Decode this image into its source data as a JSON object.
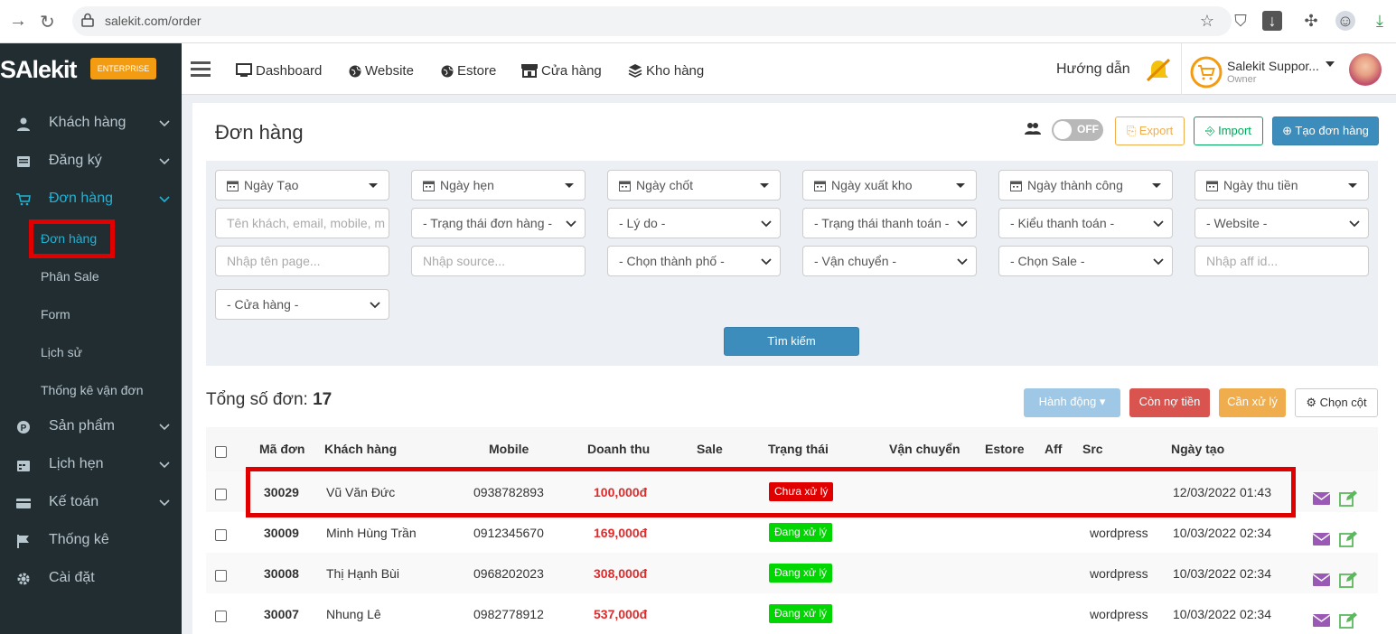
{
  "browser": {
    "url": "salekit.com/order"
  },
  "logo": {
    "text": "SAlekit",
    "badge": "ENTERPRISE"
  },
  "sidebar": {
    "items": [
      {
        "label": "Khách hàng",
        "icon": "user-icon"
      },
      {
        "label": "Đăng ký",
        "icon": "list-icon"
      },
      {
        "label": "Đơn hàng",
        "icon": "cart-icon"
      },
      {
        "label": "Sản phẩm",
        "icon": "product-icon"
      },
      {
        "label": "Lịch hẹn",
        "icon": "calendar-icon"
      },
      {
        "label": "Kế toán",
        "icon": "card-icon"
      },
      {
        "label": "Thống kê",
        "icon": "flag-icon"
      },
      {
        "label": "Cài đặt",
        "icon": "gear-icon"
      }
    ],
    "subitems": [
      "Đơn hàng",
      "Phân Sale",
      "Form",
      "Lịch sử",
      "Thống kê vận đơn"
    ]
  },
  "topnav": {
    "items": [
      "Dashboard",
      "Website",
      "Estore",
      "Cửa hàng",
      "Kho hàng"
    ],
    "guide": "Hướng dẫn",
    "user_name": "Salekit Suppor...",
    "user_role": "Owner"
  },
  "page": {
    "title": "Đơn hàng",
    "toggle": "OFF",
    "export": "Export",
    "import": "Import",
    "create": "Tạo đơn hàng"
  },
  "filters": {
    "dates": [
      "Ngày Tạo",
      "Ngày hẹn",
      "Ngày chốt",
      "Ngày xuất kho",
      "Ngày thành công",
      "Ngày thu tiền"
    ],
    "customer_placeholder": "Tên khách, email, mobile, m",
    "selects_row2": [
      "- Trạng thái đơn hàng -",
      "- Lý do -",
      "- Trạng thái thanh toán -",
      "- Kiểu thanh toán -",
      "- Website -"
    ],
    "page_placeholder": "Nhập tên page...",
    "source_placeholder": "Nhập source...",
    "selects_row3": [
      "- Chọn thành phố -",
      "- Vận chuyển -",
      "- Chọn Sale -"
    ],
    "aff_placeholder": "Nhập aff id...",
    "store": "- Cửa hàng -",
    "search": "Tìm kiếm"
  },
  "summary": {
    "label": "Tổng số đơn:",
    "count": "17"
  },
  "actions": {
    "action": "Hành động",
    "debt": "Còn nợ tiền",
    "pending": "Cần xử lý",
    "columns": "Chọn cột"
  },
  "table": {
    "headers": [
      "Mã đơn",
      "Khách hàng",
      "Mobile",
      "Doanh thu",
      "Sale",
      "Trạng thái",
      "Vận chuyển",
      "Estore",
      "Aff",
      "Src",
      "Ngày tạo"
    ],
    "rows": [
      {
        "id": "30029",
        "customer": "Vũ Văn Đức",
        "mobile": "0938782893",
        "revenue": "100,000đ",
        "status": "Chưa xử lý",
        "status_color": "#e00000",
        "src": "",
        "date": "12/03/2022 01:43"
      },
      {
        "id": "30009",
        "customer": "Minh Hùng Trần",
        "mobile": "0912345670",
        "revenue": "169,000đ",
        "status": "Đang xử lý",
        "status_color": "#00d600",
        "src": "wordpress",
        "date": "10/03/2022 02:34"
      },
      {
        "id": "30008",
        "customer": "Thị Hạnh Bùi",
        "mobile": "0968202023",
        "revenue": "308,000đ",
        "status": "Đang xử lý",
        "status_color": "#00d600",
        "src": "wordpress",
        "date": "10/03/2022 02:34"
      },
      {
        "id": "30007",
        "customer": "Nhung Lê",
        "mobile": "0982778912",
        "revenue": "537,000đ",
        "status": "Đang xử lý",
        "status_color": "#00d600",
        "src": "wordpress",
        "date": "10/03/2022 02:34"
      }
    ]
  }
}
